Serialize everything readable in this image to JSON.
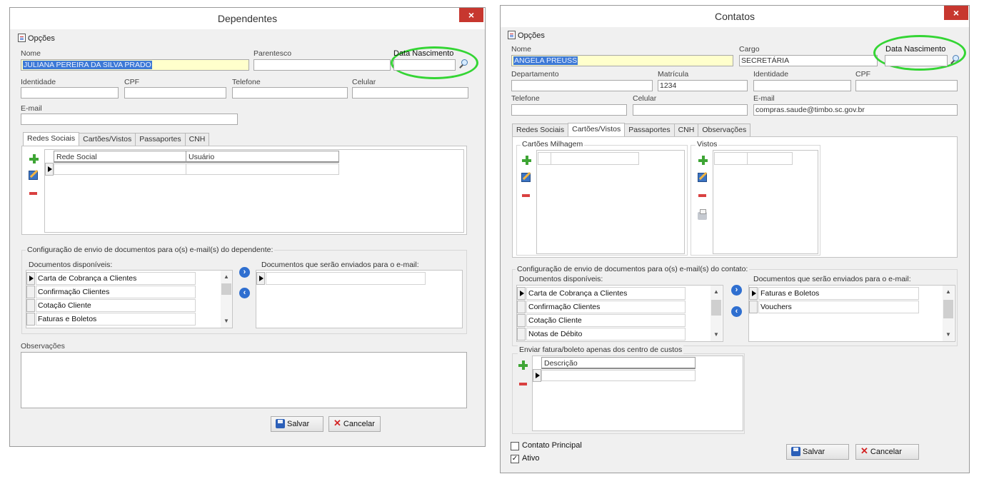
{
  "dependentes": {
    "title": "Dependentes",
    "close": "×",
    "menu": "Opções",
    "fields": {
      "nome_label": "Nome",
      "nome_value": "JULIANA PEREIRA DA SILVA PRADO",
      "parentesco_label": "Parentesco",
      "data_nascimento_label": "Data Nascimento",
      "identidade_label": "Identidade",
      "cpf_label": "CPF",
      "telefone_label": "Telefone",
      "celular_label": "Celular",
      "email_label": "E-mail"
    },
    "tabs": [
      "Redes Sociais",
      "Cartões/Vistos",
      "Passaportes",
      "CNH"
    ],
    "redes_grid": {
      "col1": "Rede Social",
      "col2": "Usuário"
    },
    "config_title": "Configuração de envio de documentos para o(s) e-mail(s) do dependente:",
    "disponiveis_title": "Documentos disponíveis:",
    "disponiveis": [
      "Carta de Cobrança a Clientes",
      "Confirmação Clientes",
      "Cotação Cliente",
      "Faturas e Boletos"
    ],
    "enviados_title": "Documentos que serão enviados para o e-mail:",
    "observacoes_label": "Observações",
    "salvar": "Salvar",
    "cancelar": "Cancelar"
  },
  "contatos": {
    "title": "Contatos",
    "close": "×",
    "menu": "Opções",
    "fields": {
      "nome_label": "Nome",
      "nome_value": "ANGELA PREUSS",
      "cargo_label": "Cargo",
      "cargo_value": "SECRETÁRIA",
      "data_nascimento_label": "Data Nascimento",
      "departamento_label": "Departamento",
      "matricula_label": "Matrícula",
      "matricula_value": "1234",
      "identidade_label": "Identidade",
      "cpf_label": "CPF",
      "telefone_label": "Telefone",
      "celular_label": "Celular",
      "email_label": "E-mail",
      "email_value": "compras.saude@timbo.sc.gov.br"
    },
    "tabs": [
      "Redes Sociais",
      "Cartões/Vistos",
      "Passaportes",
      "CNH",
      "Observações"
    ],
    "cartoes_title": "Cartões Milhagem",
    "vistos_title": "Vistos",
    "config_title": "Configuração de envio de documentos para o(s) e-mail(s) do contato:",
    "disponiveis_title": "Documentos disponíveis:",
    "disponiveis": [
      "Carta de Cobrança a Clientes",
      "Confirmação Clientes",
      "Cotação Cliente",
      "Notas de Débito"
    ],
    "enviados_title": "Documentos que serão enviados para o e-mail:",
    "enviados": [
      "Faturas e Boletos",
      "Vouchers"
    ],
    "centro_title": "Enviar fatura/boleto apenas dos centro de custos",
    "centro_col": "Descrição",
    "contato_principal": "Contato Principal",
    "ativo": "Ativo",
    "ativo_check": "✓",
    "salvar": "Salvar",
    "cancelar": "Cancelar"
  },
  "colors": {
    "highlight_ring": "#34d534",
    "selection": "#3d79d6",
    "close": "#c7372f"
  }
}
